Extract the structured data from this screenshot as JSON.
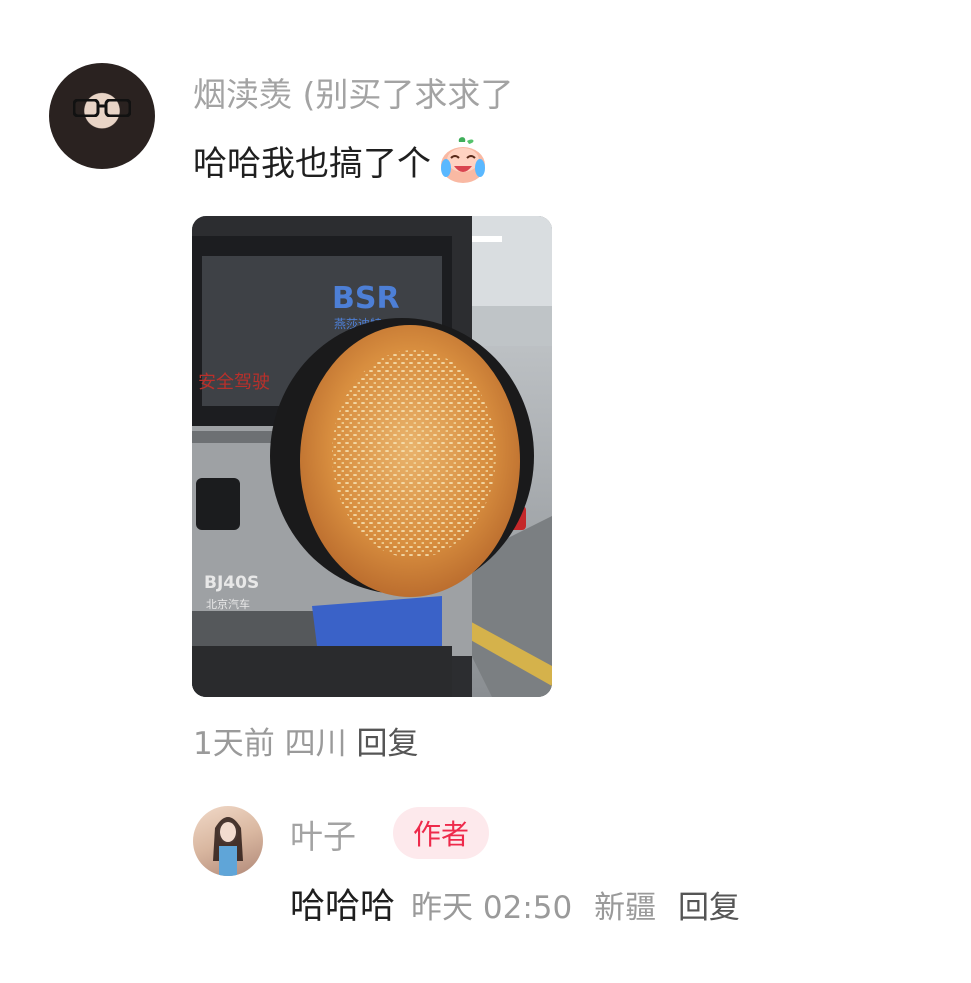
{
  "comment": {
    "author": "烟渎羡 (别买了求求了",
    "text": "哈哈我也搞了个",
    "emoji": "crying-laughing-peach-emoji",
    "photo": {
      "description_icon": "photo-thumbnail",
      "rear_window_text": "BSR",
      "rear_window_subtext": "燕莎迪特",
      "sticker_text": "安全驾驶",
      "badge_text": "BJ40S",
      "brand_text": "北京汽车"
    },
    "meta": {
      "time": "1天前",
      "location": "四川",
      "reply": "回复"
    }
  },
  "reply": {
    "author": "叶子",
    "author_badge": "作者",
    "text": "哈哈哈",
    "time": "昨天 02:50",
    "location": "新疆",
    "reply": "回复"
  },
  "colors": {
    "name_gray": "#a3a3a3",
    "text_dark": "#1f1f1f",
    "meta_gray": "#9a9a9a",
    "badge_red": "#ee2a4b",
    "badge_bg": "#fde9ec"
  }
}
